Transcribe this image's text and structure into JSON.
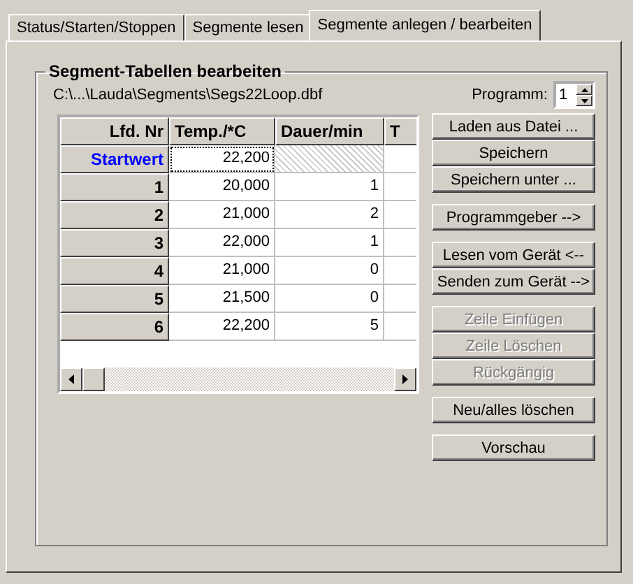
{
  "tabs": [
    {
      "label": "Status/Starten/Stoppen",
      "selected": false
    },
    {
      "label": "Segmente lesen",
      "selected": false
    },
    {
      "label": "Segmente anlegen / bearbeiten",
      "selected": true
    }
  ],
  "group": {
    "title": "Segment-Tabellen bearbeiten",
    "path": "C:\\...\\Lauda\\Segments\\Segs22Loop.dbf",
    "program_label": "Programm:",
    "program_value": "1"
  },
  "table": {
    "columns": [
      "Lfd. Nr",
      "Temp./*C",
      "Dauer/min",
      "T"
    ],
    "rows": [
      {
        "kind": "start",
        "nr": "Startwert",
        "temp": "22,200",
        "focused": true
      },
      {
        "kind": "segment",
        "nr": "1",
        "temp": "20,000",
        "dauer": "1",
        "focused": false
      },
      {
        "kind": "segment",
        "nr": "2",
        "temp": "21,000",
        "dauer": "2",
        "focused": false
      },
      {
        "kind": "segment",
        "nr": "3",
        "temp": "22,000",
        "dauer": "1",
        "focused": false
      },
      {
        "kind": "segment",
        "nr": "4",
        "temp": "21,000",
        "dauer": "0",
        "focused": false
      },
      {
        "kind": "segment",
        "nr": "5",
        "temp": "21,500",
        "dauer": "0",
        "focused": false
      },
      {
        "kind": "segment",
        "nr": "6",
        "temp": "22,200",
        "dauer": "5",
        "focused": false
      }
    ]
  },
  "button_groups": [
    [
      {
        "label": "Laden aus Datei ...",
        "disabled": false
      },
      {
        "label": "Speichern",
        "disabled": false
      },
      {
        "label": "Speichern unter ...",
        "disabled": false
      }
    ],
    [
      {
        "label": "Programmgeber -->",
        "disabled": false
      }
    ],
    [
      {
        "label": "Lesen vom Gerät <--",
        "disabled": false
      },
      {
        "label": "Senden zum Gerät -->",
        "disabled": false
      }
    ],
    [
      {
        "label": "Zeile Einfügen",
        "disabled": true
      },
      {
        "label": "Zeile Löschen",
        "disabled": true
      },
      {
        "label": "Rückgängig",
        "disabled": true
      }
    ],
    [
      {
        "label": "Neu/alles löschen",
        "disabled": false
      }
    ],
    [
      {
        "label": "Vorschau",
        "disabled": false
      }
    ]
  ]
}
